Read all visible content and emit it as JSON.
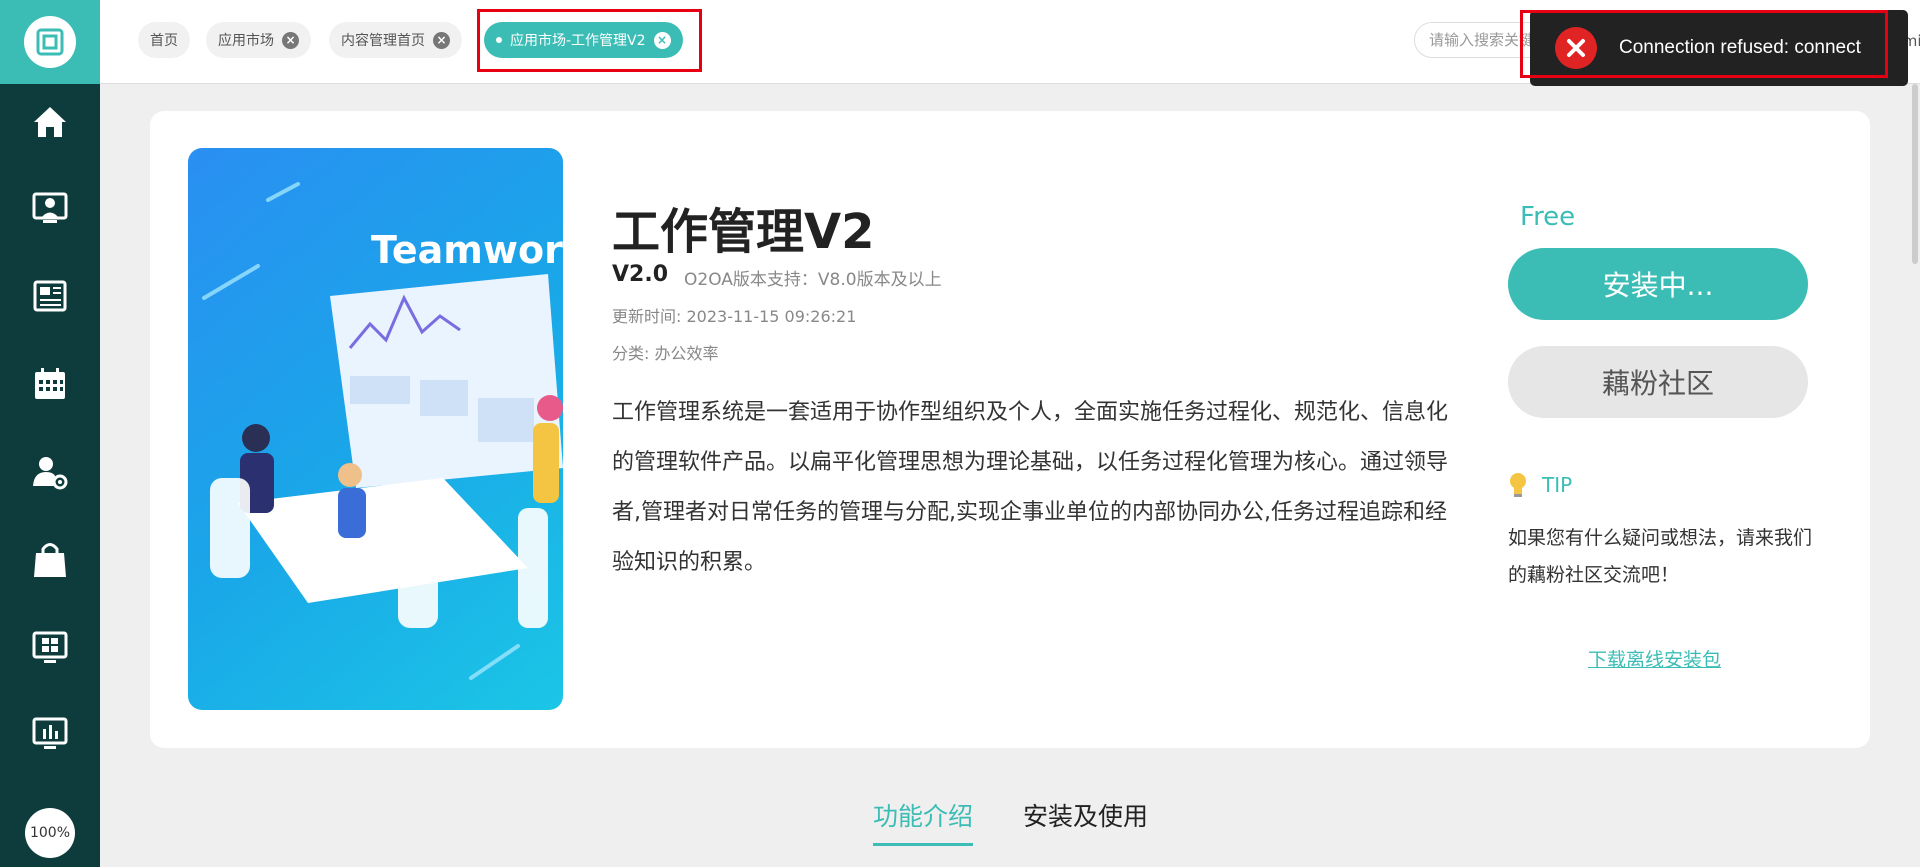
{
  "sidebar": {
    "items": [
      {
        "icon": "home-icon"
      },
      {
        "icon": "user-portal-icon"
      },
      {
        "icon": "news-icon"
      },
      {
        "icon": "calendar-icon"
      },
      {
        "icon": "user-settings-icon"
      },
      {
        "icon": "shopping-bag-icon"
      },
      {
        "icon": "app-grid-icon"
      },
      {
        "icon": "monitor-chart-icon"
      }
    ],
    "zoom": "100%"
  },
  "tabs": [
    {
      "label": "首页",
      "closable": false
    },
    {
      "label": "应用市场",
      "closable": true
    },
    {
      "label": "内容管理首页",
      "closable": true
    },
    {
      "label": "应用市场-工作管理V2",
      "closable": true,
      "active": true
    }
  ],
  "search": {
    "placeholder": "请输入搜索关键字"
  },
  "user": {
    "name": "admin"
  },
  "toast": {
    "message": "Connection refused: connect"
  },
  "app": {
    "banner_title": "Teamwork",
    "title": "工作管理V2",
    "version": "V2.0",
    "support": "O2OA版本支持：V8.0版本及以上",
    "updated": "更新时间: 2023-11-15 09:26:21",
    "category": "分类: 办公效率",
    "description": "工作管理系统是一套适用于协作型组织及个人，全面实施任务过程化、规范化、信息化的管理软件产品。以扁平化管理思想为理论基础，以任务过程化管理为核心。通过领导者,管理者对日常任务的管理与分配,实现企事业单位的内部协同办公,任务过程追踪和经验知识的积累。"
  },
  "actions": {
    "price": "Free",
    "install_label": "安装中...",
    "community_label": "藕粉社区",
    "tip_label": "TIP",
    "tip_text": "如果您有什么疑问或想法，请来我们的藕粉社区交流吧！",
    "download_label": "下载离线安装包"
  },
  "content_tabs": [
    {
      "label": "功能介绍",
      "active": true
    },
    {
      "label": "安装及使用",
      "active": false
    }
  ],
  "colors": {
    "accent": "#3bbdb6",
    "sidebar_bg": "#0e3c3d",
    "error": "#e02424",
    "highlight_border": "#e60012"
  }
}
